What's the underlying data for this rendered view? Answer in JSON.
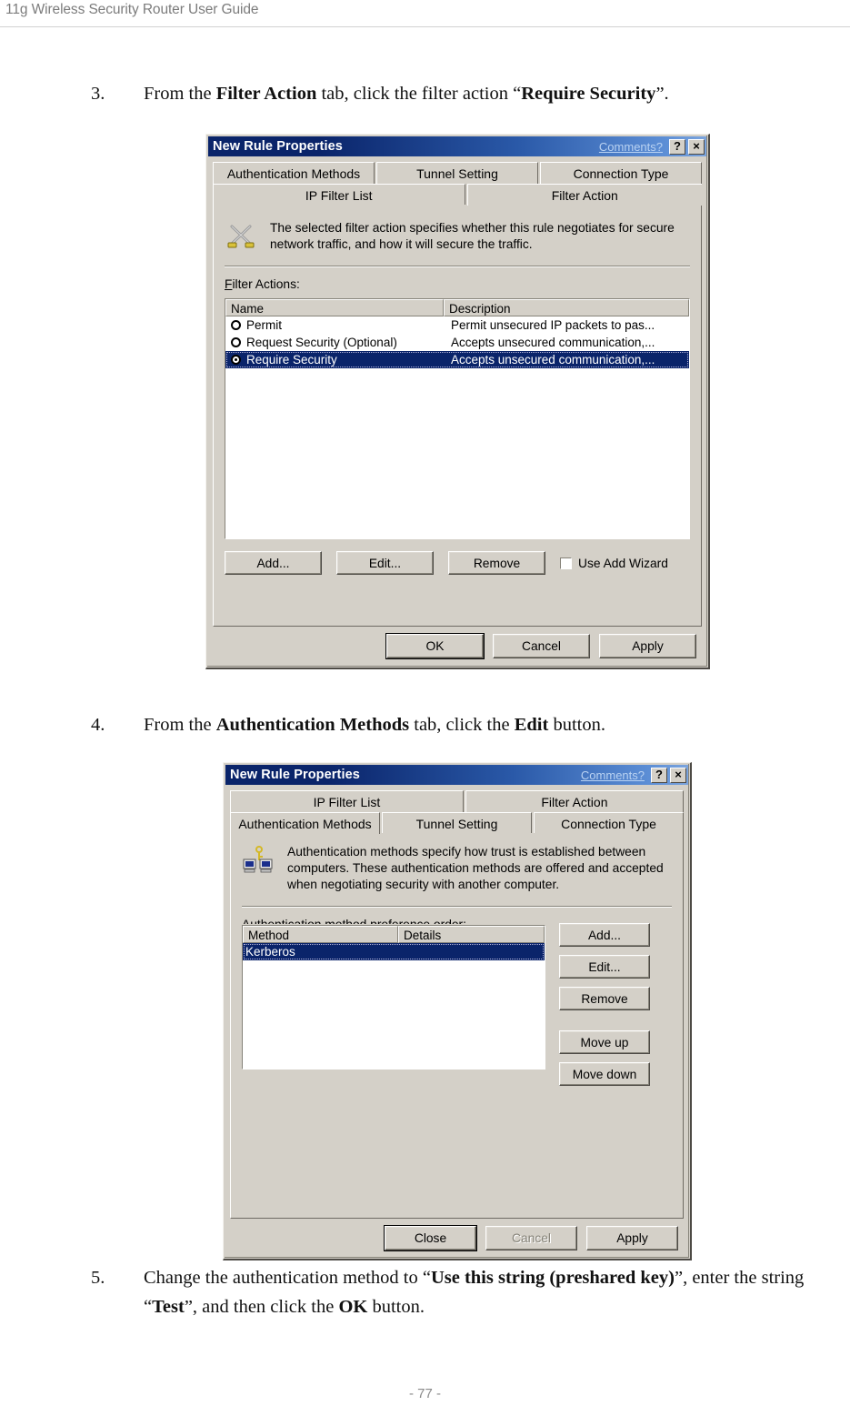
{
  "page": {
    "header": "11g Wireless Security Router User Guide",
    "footer": "- 77 -"
  },
  "steps": {
    "step3": {
      "number": "3.",
      "parts": [
        "From the ",
        "Filter Action",
        " tab, click the filter action “",
        "Require Security",
        "”."
      ]
    },
    "step4": {
      "number": "4.",
      "parts": [
        "From the ",
        "Authentication Methods",
        " tab, click the ",
        "Edit",
        " button."
      ]
    },
    "step5": {
      "number": "5.",
      "parts": [
        "Change the authentication method to “",
        "Use this string (preshared key)",
        "”, enter the string “",
        "Test",
        "”, and then click the ",
        "OK",
        " button."
      ]
    }
  },
  "dialog_filter_action": {
    "title": "New Rule Properties",
    "comments_link": "Comments?",
    "help_button": "?",
    "close_button": "×",
    "tabs_row_top": [
      {
        "label": "Authentication Methods",
        "selected": false
      },
      {
        "label": "Tunnel Setting",
        "selected": false
      },
      {
        "label": "Connection Type",
        "selected": false
      }
    ],
    "tabs_row_bottom": [
      {
        "label": "IP Filter List",
        "selected": false
      },
      {
        "label": "Filter Action",
        "selected": true
      }
    ],
    "description": "The selected filter action specifies whether this rule negotiates for secure network traffic, and how it will secure the traffic.",
    "icon": "crossed-swords-icon",
    "list_label": "Filter Actions:",
    "list_label_accel": "F",
    "columns": [
      "Name",
      "Description"
    ],
    "rows": [
      {
        "name": "Permit",
        "description": "Permit unsecured IP packets to pas...",
        "selected": false
      },
      {
        "name": "Request Security (Optional)",
        "description": "Accepts unsecured communication,...",
        "selected": false
      },
      {
        "name": "Require Security",
        "description": "Accepts unsecured communication,...",
        "selected": true
      }
    ],
    "buttons": [
      {
        "label": "Add...",
        "accel": "d"
      },
      {
        "label": "Edit...",
        "accel": "E"
      },
      {
        "label": "Remove",
        "accel": "R"
      }
    ],
    "checkbox": {
      "label": "Use Add Wizard",
      "accel": "W",
      "checked": false
    },
    "footer_buttons": [
      {
        "label": "OK",
        "default": true,
        "disabled": false
      },
      {
        "label": "Cancel",
        "default": false,
        "disabled": false
      },
      {
        "label": "Apply",
        "accel": "A",
        "default": false,
        "disabled": false
      }
    ]
  },
  "dialog_auth_methods": {
    "title": "New Rule Properties",
    "comments_link": "Comments?",
    "help_button": "?",
    "close_button": "×",
    "tabs_row_top": [
      {
        "label": "IP Filter List",
        "selected": false
      },
      {
        "label": "Filter Action",
        "selected": false
      }
    ],
    "tabs_row_bottom": [
      {
        "label": "Authentication Methods",
        "selected": true
      },
      {
        "label": "Tunnel Setting",
        "selected": false
      },
      {
        "label": "Connection Type",
        "selected": false
      }
    ],
    "description": "Authentication methods specify how trust is established between computers. These authentication methods are offered and accepted when negotiating security with another computer.",
    "icon": "two-computers-key-icon",
    "list_label": "Authentication method preference order:",
    "columns": [
      "Method",
      "Details"
    ],
    "rows": [
      {
        "method": "Kerberos",
        "details": "",
        "selected": true
      }
    ],
    "side_buttons": [
      {
        "label": "Add...",
        "accel": "d"
      },
      {
        "label": "Edit...",
        "accel": "E"
      },
      {
        "label": "Remove",
        "accel": "R"
      },
      {
        "label": "Move up",
        "accel": "u"
      },
      {
        "label": "Move down",
        "accel": "o"
      }
    ],
    "footer_buttons": [
      {
        "label": "Close",
        "default": true,
        "disabled": false
      },
      {
        "label": "Cancel",
        "default": false,
        "disabled": true
      },
      {
        "label": "Apply",
        "accel": "A",
        "default": false,
        "disabled": false
      }
    ]
  },
  "colors": {
    "titlebar_start": "#0a246a",
    "titlebar_end": "#7ba4dd",
    "dialog_face": "#d4d0c8",
    "selection": "#0a246a",
    "header_text": "#7c7c7c"
  }
}
